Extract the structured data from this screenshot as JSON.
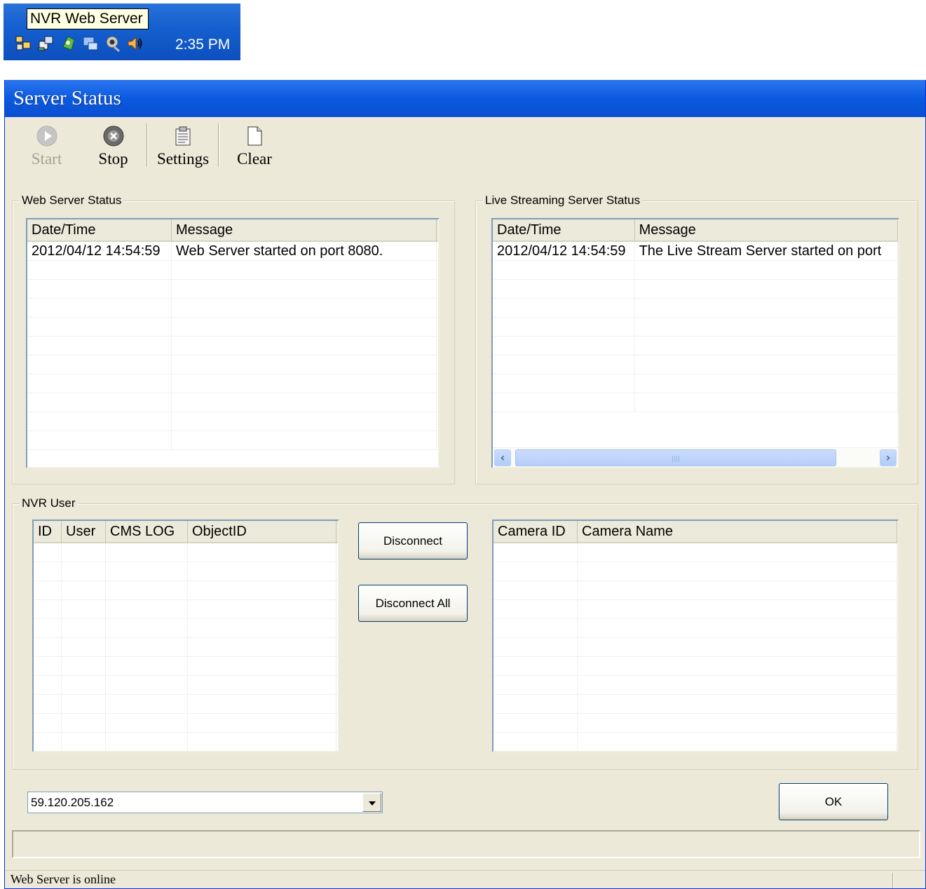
{
  "tray": {
    "tooltip": "NVR Web Server",
    "clock": "2:35 PM",
    "icons": [
      "network-icon",
      "network-connection-icon",
      "security-shield-icon",
      "monitor-icon",
      "webcam-icon",
      "volume-icon"
    ]
  },
  "window": {
    "title": "Server Status"
  },
  "toolbar": {
    "start_label": "Start",
    "stop_label": "Stop",
    "settings_label": "Settings",
    "clear_label": "Clear"
  },
  "web_server": {
    "group_title": "Web Server Status",
    "columns": [
      "Date/Time",
      "Message"
    ],
    "rows": [
      {
        "datetime": "2012/04/12 14:54:59",
        "message": "Web Server started on port 8080."
      }
    ]
  },
  "live_streaming": {
    "group_title": "Live Streaming Server Status",
    "columns": [
      "Date/Time",
      "Message"
    ],
    "rows": [
      {
        "datetime": "2012/04/12 14:54:59",
        "message": "The Live Stream Server started on port"
      }
    ]
  },
  "nvr_user": {
    "group_title": "NVR User",
    "user_columns": [
      "ID",
      "User",
      "CMS LOG",
      "ObjectID"
    ],
    "camera_columns": [
      "Camera ID",
      "Camera Name"
    ],
    "disconnect_label": "Disconnect",
    "disconnect_all_label": "Disconnect All"
  },
  "ip_select": {
    "value": "59.120.205.162"
  },
  "ok_label": "OK",
  "status": {
    "text": "Web Server is online"
  }
}
